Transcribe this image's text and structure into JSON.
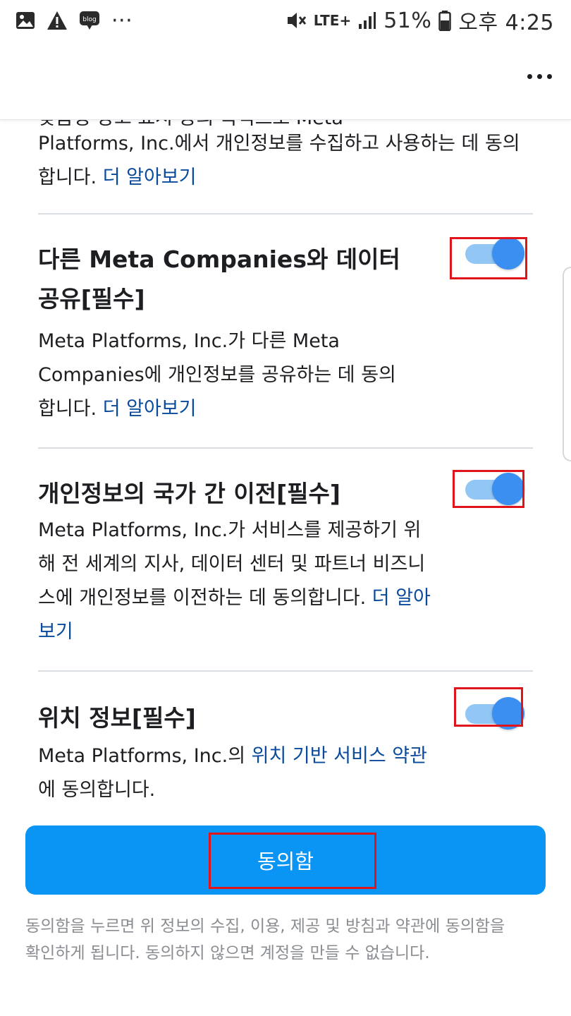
{
  "status_bar": {
    "icons": [
      "image-icon",
      "warning-icon",
      "blog-icon",
      "more-notifications-icon",
      "mute-icon",
      "lte-signal-icon",
      "battery-icon"
    ],
    "blog_label": "blog",
    "more_notifications": "···",
    "network": "LTE+",
    "battery": "51%",
    "time": "오후 4:25"
  },
  "intro_partial": {
    "cut_line": "맞춤형 광고 표시 등의 목적으로 Meta",
    "text_before_link": "Platforms, Inc.에서 개인정보를 수집하고 사용하는 데 동의합니다. ",
    "link": "더 알아보기"
  },
  "sections": [
    {
      "title": "다른 Meta Companies와 데이터 공유[필수]",
      "body": "Meta Platforms, Inc.가 다른 Meta Companies에 개인정보를 공유하는 데 동의합니다. ",
      "link": "더 알아보기",
      "toggle_on": true
    },
    {
      "title": "개인정보의 국가 간 이전[필수]",
      "body": "Meta Platforms, Inc.가 서비스를 제공하기 위해 전 세계의 지사, 데이터 센터 및 파트너 비즈니스에 개인정보를 이전하는 데 동의합니다. ",
      "link": "더 알아보기",
      "toggle_on": true
    },
    {
      "title": "위치 정보[필수]",
      "body_before_link": "Meta Platforms, Inc.의 ",
      "link": "위치 기반 서비스 약관",
      "body_after_link": "에 동의합니다.",
      "toggle_on": true
    }
  ],
  "agree_button": "동의함",
  "footnote": "동의함을 누르면 위 정보의 수집, 이용, 제공 및 방침과 약관에 동의함을 확인하게 됩니다. 동의하지 않으면 계정을 만들 수 없습니다.",
  "colors": {
    "accent": "#0a95f5",
    "link": "#0a4a9c",
    "toggle_track": "#92c6f5",
    "toggle_knob": "#3a8ff0",
    "highlight_box": "#e0151c"
  }
}
